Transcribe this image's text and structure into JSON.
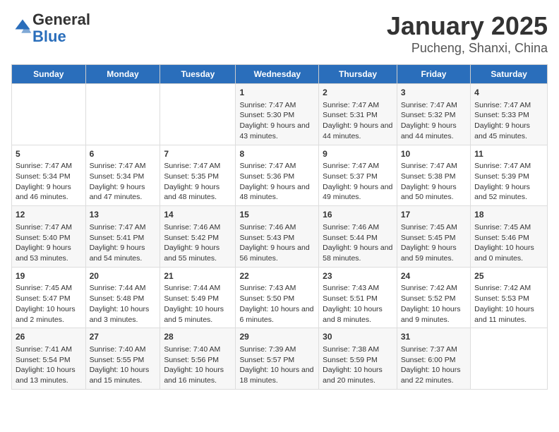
{
  "header": {
    "logo_general": "General",
    "logo_blue": "Blue",
    "title": "January 2025",
    "subtitle": "Pucheng, Shanxi, China"
  },
  "days_of_week": [
    "Sunday",
    "Monday",
    "Tuesday",
    "Wednesday",
    "Thursday",
    "Friday",
    "Saturday"
  ],
  "weeks": [
    [
      {
        "day": "",
        "content": ""
      },
      {
        "day": "",
        "content": ""
      },
      {
        "day": "",
        "content": ""
      },
      {
        "day": "1",
        "content": "Sunrise: 7:47 AM\nSunset: 5:30 PM\nDaylight: 9 hours and 43 minutes."
      },
      {
        "day": "2",
        "content": "Sunrise: 7:47 AM\nSunset: 5:31 PM\nDaylight: 9 hours and 44 minutes."
      },
      {
        "day": "3",
        "content": "Sunrise: 7:47 AM\nSunset: 5:32 PM\nDaylight: 9 hours and 44 minutes."
      },
      {
        "day": "4",
        "content": "Sunrise: 7:47 AM\nSunset: 5:33 PM\nDaylight: 9 hours and 45 minutes."
      }
    ],
    [
      {
        "day": "5",
        "content": "Sunrise: 7:47 AM\nSunset: 5:34 PM\nDaylight: 9 hours and 46 minutes."
      },
      {
        "day": "6",
        "content": "Sunrise: 7:47 AM\nSunset: 5:34 PM\nDaylight: 9 hours and 47 minutes."
      },
      {
        "day": "7",
        "content": "Sunrise: 7:47 AM\nSunset: 5:35 PM\nDaylight: 9 hours and 48 minutes."
      },
      {
        "day": "8",
        "content": "Sunrise: 7:47 AM\nSunset: 5:36 PM\nDaylight: 9 hours and 48 minutes."
      },
      {
        "day": "9",
        "content": "Sunrise: 7:47 AM\nSunset: 5:37 PM\nDaylight: 9 hours and 49 minutes."
      },
      {
        "day": "10",
        "content": "Sunrise: 7:47 AM\nSunset: 5:38 PM\nDaylight: 9 hours and 50 minutes."
      },
      {
        "day": "11",
        "content": "Sunrise: 7:47 AM\nSunset: 5:39 PM\nDaylight: 9 hours and 52 minutes."
      }
    ],
    [
      {
        "day": "12",
        "content": "Sunrise: 7:47 AM\nSunset: 5:40 PM\nDaylight: 9 hours and 53 minutes."
      },
      {
        "day": "13",
        "content": "Sunrise: 7:47 AM\nSunset: 5:41 PM\nDaylight: 9 hours and 54 minutes."
      },
      {
        "day": "14",
        "content": "Sunrise: 7:46 AM\nSunset: 5:42 PM\nDaylight: 9 hours and 55 minutes."
      },
      {
        "day": "15",
        "content": "Sunrise: 7:46 AM\nSunset: 5:43 PM\nDaylight: 9 hours and 56 minutes."
      },
      {
        "day": "16",
        "content": "Sunrise: 7:46 AM\nSunset: 5:44 PM\nDaylight: 9 hours and 58 minutes."
      },
      {
        "day": "17",
        "content": "Sunrise: 7:45 AM\nSunset: 5:45 PM\nDaylight: 9 hours and 59 minutes."
      },
      {
        "day": "18",
        "content": "Sunrise: 7:45 AM\nSunset: 5:46 PM\nDaylight: 10 hours and 0 minutes."
      }
    ],
    [
      {
        "day": "19",
        "content": "Sunrise: 7:45 AM\nSunset: 5:47 PM\nDaylight: 10 hours and 2 minutes."
      },
      {
        "day": "20",
        "content": "Sunrise: 7:44 AM\nSunset: 5:48 PM\nDaylight: 10 hours and 3 minutes."
      },
      {
        "day": "21",
        "content": "Sunrise: 7:44 AM\nSunset: 5:49 PM\nDaylight: 10 hours and 5 minutes."
      },
      {
        "day": "22",
        "content": "Sunrise: 7:43 AM\nSunset: 5:50 PM\nDaylight: 10 hours and 6 minutes."
      },
      {
        "day": "23",
        "content": "Sunrise: 7:43 AM\nSunset: 5:51 PM\nDaylight: 10 hours and 8 minutes."
      },
      {
        "day": "24",
        "content": "Sunrise: 7:42 AM\nSunset: 5:52 PM\nDaylight: 10 hours and 9 minutes."
      },
      {
        "day": "25",
        "content": "Sunrise: 7:42 AM\nSunset: 5:53 PM\nDaylight: 10 hours and 11 minutes."
      }
    ],
    [
      {
        "day": "26",
        "content": "Sunrise: 7:41 AM\nSunset: 5:54 PM\nDaylight: 10 hours and 13 minutes."
      },
      {
        "day": "27",
        "content": "Sunrise: 7:40 AM\nSunset: 5:55 PM\nDaylight: 10 hours and 15 minutes."
      },
      {
        "day": "28",
        "content": "Sunrise: 7:40 AM\nSunset: 5:56 PM\nDaylight: 10 hours and 16 minutes."
      },
      {
        "day": "29",
        "content": "Sunrise: 7:39 AM\nSunset: 5:57 PM\nDaylight: 10 hours and 18 minutes."
      },
      {
        "day": "30",
        "content": "Sunrise: 7:38 AM\nSunset: 5:59 PM\nDaylight: 10 hours and 20 minutes."
      },
      {
        "day": "31",
        "content": "Sunrise: 7:37 AM\nSunset: 6:00 PM\nDaylight: 10 hours and 22 minutes."
      },
      {
        "day": "",
        "content": ""
      }
    ]
  ]
}
